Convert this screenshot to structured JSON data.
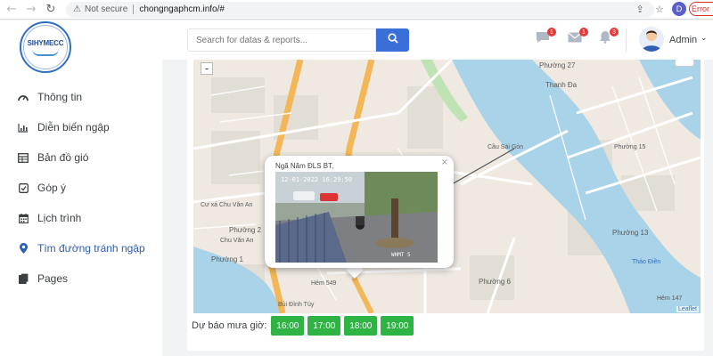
{
  "browser": {
    "security_label": "Not secure",
    "url": "chongngaphcm.info/#",
    "profile_initial": "D",
    "error_label": "Error"
  },
  "brand": {
    "logo_text": "SIHYMECC"
  },
  "sidebar": {
    "items": [
      {
        "label": "Thông tin",
        "icon": "gauge-icon"
      },
      {
        "label": "Diễn biến ngập",
        "icon": "bar-chart-icon"
      },
      {
        "label": "Bản đồ gió",
        "icon": "table-icon"
      },
      {
        "label": "Góp ý",
        "icon": "checkbox-icon"
      },
      {
        "label": "Lịch trình",
        "icon": "calendar-icon"
      },
      {
        "label": "Tìm đường tránh ngập",
        "icon": "map-pin-icon",
        "active": true
      },
      {
        "label": "Pages",
        "icon": "pages-icon"
      }
    ]
  },
  "header": {
    "search_placeholder": "Search for datas & reports...",
    "messages_badge": "1",
    "mail_badge": "1",
    "alerts_badge": "3",
    "user_name": "Admin"
  },
  "map": {
    "zoom_out": "-",
    "attribution": "Leaflet",
    "labels": [
      "Phường 27",
      "Thanh Đa",
      "Phường 15",
      "Phường 1",
      "Phường 6",
      "Phường 2",
      "Phường 13",
      "Thảo Điền",
      "Hẻm 147",
      "Hẻm 549",
      "Bùi Đình Túy",
      "Chu Văn An",
      "Cầu Sài Gòn",
      "Cư xá Chu Văn An"
    ],
    "popup": {
      "title": "Ngã Năm ĐLS BT,",
      "close": "×",
      "cam_timestamp": "12-01-2022 16:29:50",
      "cam_label": "WHMT 5"
    }
  },
  "forecast": {
    "label": "Dự báo mưa giờ:",
    "hours": [
      "16:00",
      "17:00",
      "18:00",
      "19:00"
    ]
  },
  "colors": {
    "accent": "#3b6fd8",
    "active_menu": "#2f5fb0",
    "forecast_button": "#2fb344",
    "badge": "#e53935",
    "river": "#a9d3e8"
  }
}
